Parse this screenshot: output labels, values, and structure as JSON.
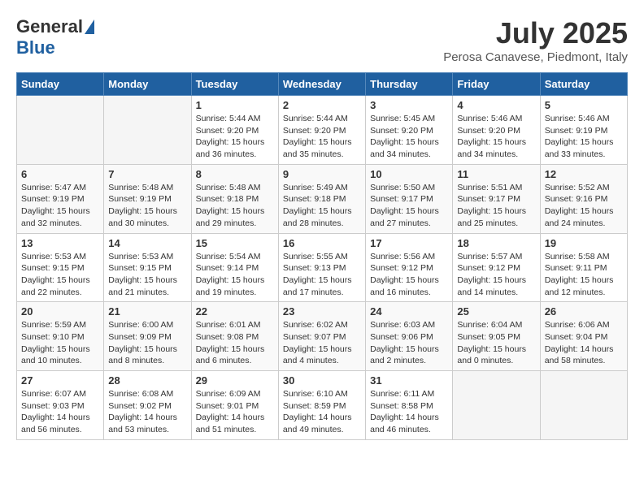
{
  "header": {
    "logo_general": "General",
    "logo_blue": "Blue",
    "month_title": "July 2025",
    "subtitle": "Perosa Canavese, Piedmont, Italy"
  },
  "days_of_week": [
    "Sunday",
    "Monday",
    "Tuesday",
    "Wednesday",
    "Thursday",
    "Friday",
    "Saturday"
  ],
  "weeks": [
    [
      {
        "num": "",
        "empty": true
      },
      {
        "num": "",
        "empty": true
      },
      {
        "num": "1",
        "sunrise": "5:44 AM",
        "sunset": "9:20 PM",
        "daylight": "15 hours and 36 minutes."
      },
      {
        "num": "2",
        "sunrise": "5:44 AM",
        "sunset": "9:20 PM",
        "daylight": "15 hours and 35 minutes."
      },
      {
        "num": "3",
        "sunrise": "5:45 AM",
        "sunset": "9:20 PM",
        "daylight": "15 hours and 34 minutes."
      },
      {
        "num": "4",
        "sunrise": "5:46 AM",
        "sunset": "9:20 PM",
        "daylight": "15 hours and 34 minutes."
      },
      {
        "num": "5",
        "sunrise": "5:46 AM",
        "sunset": "9:19 PM",
        "daylight": "15 hours and 33 minutes."
      }
    ],
    [
      {
        "num": "6",
        "sunrise": "5:47 AM",
        "sunset": "9:19 PM",
        "daylight": "15 hours and 32 minutes."
      },
      {
        "num": "7",
        "sunrise": "5:48 AM",
        "sunset": "9:19 PM",
        "daylight": "15 hours and 30 minutes."
      },
      {
        "num": "8",
        "sunrise": "5:48 AM",
        "sunset": "9:18 PM",
        "daylight": "15 hours and 29 minutes."
      },
      {
        "num": "9",
        "sunrise": "5:49 AM",
        "sunset": "9:18 PM",
        "daylight": "15 hours and 28 minutes."
      },
      {
        "num": "10",
        "sunrise": "5:50 AM",
        "sunset": "9:17 PM",
        "daylight": "15 hours and 27 minutes."
      },
      {
        "num": "11",
        "sunrise": "5:51 AM",
        "sunset": "9:17 PM",
        "daylight": "15 hours and 25 minutes."
      },
      {
        "num": "12",
        "sunrise": "5:52 AM",
        "sunset": "9:16 PM",
        "daylight": "15 hours and 24 minutes."
      }
    ],
    [
      {
        "num": "13",
        "sunrise": "5:53 AM",
        "sunset": "9:15 PM",
        "daylight": "15 hours and 22 minutes."
      },
      {
        "num": "14",
        "sunrise": "5:53 AM",
        "sunset": "9:15 PM",
        "daylight": "15 hours and 21 minutes."
      },
      {
        "num": "15",
        "sunrise": "5:54 AM",
        "sunset": "9:14 PM",
        "daylight": "15 hours and 19 minutes."
      },
      {
        "num": "16",
        "sunrise": "5:55 AM",
        "sunset": "9:13 PM",
        "daylight": "15 hours and 17 minutes."
      },
      {
        "num": "17",
        "sunrise": "5:56 AM",
        "sunset": "9:12 PM",
        "daylight": "15 hours and 16 minutes."
      },
      {
        "num": "18",
        "sunrise": "5:57 AM",
        "sunset": "9:12 PM",
        "daylight": "15 hours and 14 minutes."
      },
      {
        "num": "19",
        "sunrise": "5:58 AM",
        "sunset": "9:11 PM",
        "daylight": "15 hours and 12 minutes."
      }
    ],
    [
      {
        "num": "20",
        "sunrise": "5:59 AM",
        "sunset": "9:10 PM",
        "daylight": "15 hours and 10 minutes."
      },
      {
        "num": "21",
        "sunrise": "6:00 AM",
        "sunset": "9:09 PM",
        "daylight": "15 hours and 8 minutes."
      },
      {
        "num": "22",
        "sunrise": "6:01 AM",
        "sunset": "9:08 PM",
        "daylight": "15 hours and 6 minutes."
      },
      {
        "num": "23",
        "sunrise": "6:02 AM",
        "sunset": "9:07 PM",
        "daylight": "15 hours and 4 minutes."
      },
      {
        "num": "24",
        "sunrise": "6:03 AM",
        "sunset": "9:06 PM",
        "daylight": "15 hours and 2 minutes."
      },
      {
        "num": "25",
        "sunrise": "6:04 AM",
        "sunset": "9:05 PM",
        "daylight": "15 hours and 0 minutes."
      },
      {
        "num": "26",
        "sunrise": "6:06 AM",
        "sunset": "9:04 PM",
        "daylight": "14 hours and 58 minutes."
      }
    ],
    [
      {
        "num": "27",
        "sunrise": "6:07 AM",
        "sunset": "9:03 PM",
        "daylight": "14 hours and 56 minutes."
      },
      {
        "num": "28",
        "sunrise": "6:08 AM",
        "sunset": "9:02 PM",
        "daylight": "14 hours and 53 minutes."
      },
      {
        "num": "29",
        "sunrise": "6:09 AM",
        "sunset": "9:01 PM",
        "daylight": "14 hours and 51 minutes."
      },
      {
        "num": "30",
        "sunrise": "6:10 AM",
        "sunset": "8:59 PM",
        "daylight": "14 hours and 49 minutes."
      },
      {
        "num": "31",
        "sunrise": "6:11 AM",
        "sunset": "8:58 PM",
        "daylight": "14 hours and 46 minutes."
      },
      {
        "num": "",
        "empty": true
      },
      {
        "num": "",
        "empty": true
      }
    ]
  ]
}
